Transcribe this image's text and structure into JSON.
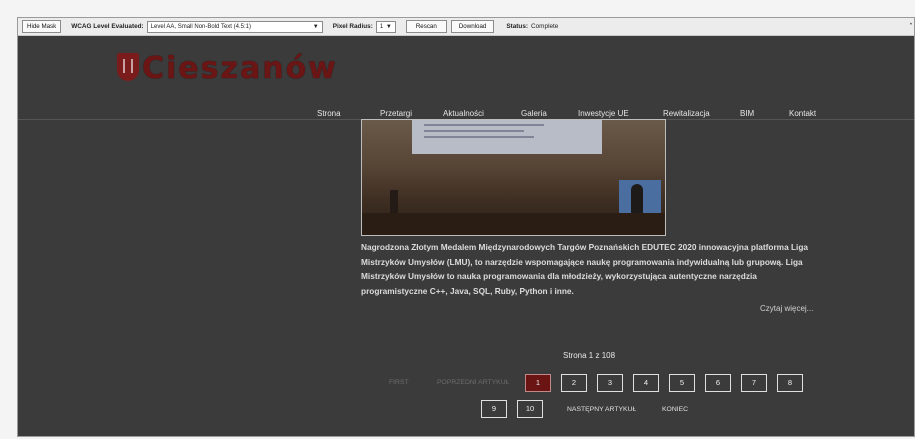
{
  "toolbar": {
    "hide_mask": "Hide Mask",
    "wcag_label": "WCAG Level Evaluated:",
    "wcag_value": "Level AA, Small Non-Bold Text (4.5:1)",
    "pixel_radius_label": "Pixel Radius:",
    "pixel_radius_value": "1",
    "rescan": "Rescan",
    "download": "Download",
    "status_label": "Status:",
    "status_value": "Complete"
  },
  "header": {
    "logo_text": "Cieszanów",
    "nav": [
      "Strona",
      "Przetargi",
      "Aktualności",
      "Galeria",
      "Inwestycje UE",
      "Rewitalizacja",
      "BIM",
      "Kontakt"
    ]
  },
  "article": {
    "text": "Nagrodzona Złotym Medalem Międzynarodowych Targów Poznańskich EDUTEC 2020 innowacyjna platforma Liga Mistrzyków Umysłów (LMU), to narzędzie wspomagające naukę programowania indywidualną lub grupową. Liga Mistrzyków Umysłów to nauka programowania dla młodzieży, wykorzystująca autentyczne narzędzia programistyczne C++, Java, SQL, Ruby, Python i inne.",
    "read_more": "Czytaj więcej..."
  },
  "pagination": {
    "info": "Strona 1 z 108",
    "first": "FIRST",
    "prev": "POPRZEDNI ARTYKUŁ",
    "pages": [
      "1",
      "2",
      "3",
      "4",
      "5",
      "6",
      "7",
      "8",
      "9",
      "10"
    ],
    "current": "1",
    "next": "NASTĘPNY ARTYKUŁ",
    "last": "KONIEC"
  },
  "colors": {
    "page_bg": "#3b3b3b",
    "accent": "#6a1414",
    "toolbar_bg": "#ececec"
  }
}
